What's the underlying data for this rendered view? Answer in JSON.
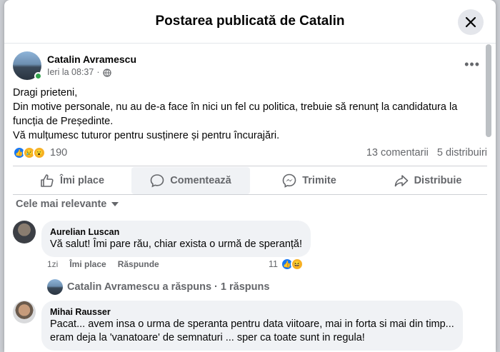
{
  "dialog": {
    "title": "Postarea publicată de Catalin"
  },
  "post": {
    "author": "Catalin Avramescu",
    "time": "Ieri la 08:37",
    "audience_icon": "globe-icon",
    "lines": [
      "Dragi prieteni,",
      "Din motive personale, nu au de-a face în nici un fel cu politica, trebuie să renunț la candidatura la funcția de Președinte.",
      "Vă mulțumesc tuturor pentru susținere și pentru încurajări."
    ],
    "reactions": {
      "icons": [
        "like-icon",
        "sad-icon",
        "wow-icon"
      ],
      "count": "190"
    },
    "comments_count": "13 comentarii",
    "shares_count": "5 distribuiri"
  },
  "actions": {
    "like": "Îmi place",
    "comment": "Comentează",
    "send": "Trimite",
    "share": "Distribuie"
  },
  "sort": {
    "label": "Cele mai relevante"
  },
  "comments": [
    {
      "name": "Aurelian Luscan",
      "text": "Vă salut! Îmi pare rău, chiar exista o urmă de speranță!",
      "time": "1zi",
      "like_label": "Îmi place",
      "reply_label": "Răspunde",
      "reaction_count": "11"
    },
    {
      "name": "Mihai Rausser",
      "text_lines": [
        "Pacat... avem insa o urma de speranta pentru data viitoare, mai in forta si mai din timp...",
        "eram deja la 'vanatoare' de semnaturi ... sper ca toate sunt in regula!"
      ]
    }
  ],
  "reply_summary": "Catalin Avramescu a răspuns · 1 răspuns",
  "colors": {
    "accent": "#1877f2",
    "online": "#31a24c",
    "secondary_text": "#65676b",
    "bubble": "#f0f2f5"
  }
}
